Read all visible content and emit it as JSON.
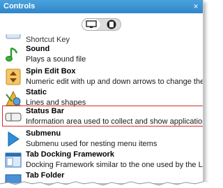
{
  "window": {
    "title": "Controls",
    "close_glyph": "×"
  },
  "toolbar": {
    "toggle": [
      {
        "icon": "monitor-icon",
        "active": true
      },
      {
        "icon": "mobile-device-icon",
        "active": false
      }
    ]
  },
  "items": [
    {
      "name": "Shortcut Key",
      "description": "",
      "icon": "shortcut-key-icon"
    },
    {
      "name": "Sound",
      "description": "Plays a sound file",
      "icon": "music-note-icon"
    },
    {
      "name": "Spin Edit Box",
      "description": "Numeric edit with up and down arrows to change the v...",
      "icon": "spin-arrows-icon"
    },
    {
      "name": "Static",
      "description": "Lines and shapes",
      "icon": "shapes-icon"
    },
    {
      "name": "Status Bar",
      "description": "Information area used to collect and show application...",
      "icon": "status-bar-icon"
    },
    {
      "name": "Submenu",
      "description": "Submenu used for nesting menu items",
      "icon": "submenu-arrow-icon"
    },
    {
      "name": "Tab Docking Framework",
      "description": "Docking Framework similar to the one used by the LAN...",
      "icon": "docking-window-icon"
    },
    {
      "name": "Tab Folder",
      "description": "",
      "icon": "tab-folder-icon"
    }
  ],
  "colors": {
    "title_bar": "#2f86c9",
    "highlight_border": "#d62b2b"
  }
}
